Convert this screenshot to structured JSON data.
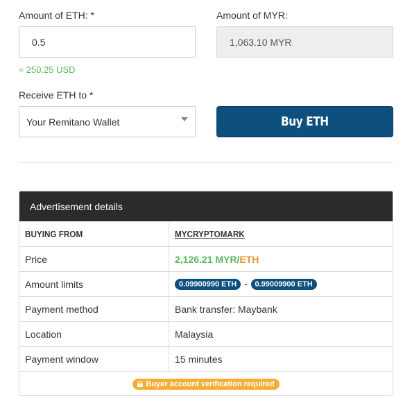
{
  "form": {
    "eth_label": "Amount of ETH: *",
    "eth_value": "0.5",
    "usd_estimate": "≈ 250.25 USD",
    "myr_label": "Amount of MYR:",
    "myr_value": "1,063.10 MYR",
    "receive_label": "Receive ETH to *",
    "receive_selected": "Your Remitano Wallet",
    "buy_button": "Buy ETH"
  },
  "ad": {
    "header": "Advertisement details",
    "buying_from_label": "BUYING FROM",
    "seller": "MYCRYPTOMARK",
    "price_label": "Price",
    "price_value": "2,126.21 MYR",
    "price_sep": "/",
    "price_unit": "ETH",
    "limits_label": "Amount limits",
    "limit_min": "0.09900990 ETH",
    "limit_sep": "-",
    "limit_max": "0.99009900 ETH",
    "payment_method_label": "Payment method",
    "payment_method_value": "Bank transfer: Maybank",
    "location_label": "Location",
    "location_value": "Malaysia",
    "window_label": "Payment window",
    "window_value": "15 minutes",
    "verification_badge": "Buyer account verification required"
  },
  "colors": {
    "primary": "#0d4f7d",
    "green": "#5cb85c",
    "orange": "#f0902a",
    "badge": "#f5a623",
    "header_bg": "#2b2b2b"
  },
  "icons": {
    "select_caret": "caret-down-icon",
    "badge_icon": "lock-icon"
  }
}
